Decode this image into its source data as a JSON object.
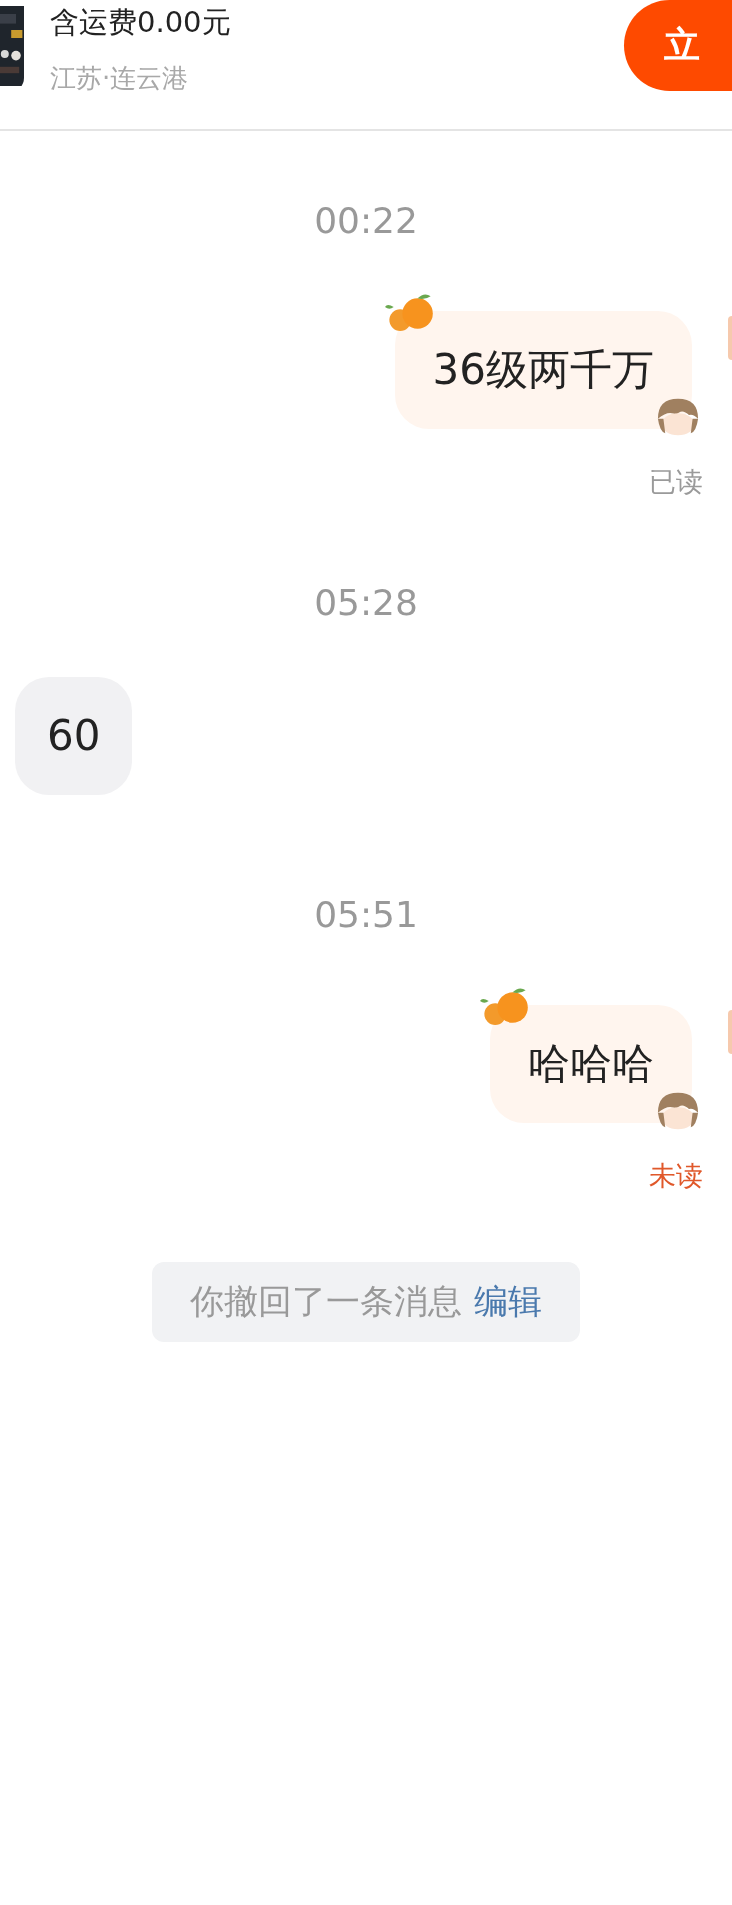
{
  "header": {
    "product_title": "含运费0.00元",
    "location": "江苏·连云港",
    "action_button": "立"
  },
  "messages": [
    {
      "kind": "time",
      "text": "00:22"
    },
    {
      "kind": "sent",
      "text": "36级两千万",
      "read": true,
      "status": "已读"
    },
    {
      "kind": "time",
      "text": "05:28"
    },
    {
      "kind": "received",
      "text": "60"
    },
    {
      "kind": "time",
      "text": "05:51"
    },
    {
      "kind": "sent",
      "text": "哈哈哈",
      "read": false,
      "status": "未读"
    },
    {
      "kind": "recall",
      "text": "你撤回了一条消息",
      "link": "编辑"
    }
  ]
}
